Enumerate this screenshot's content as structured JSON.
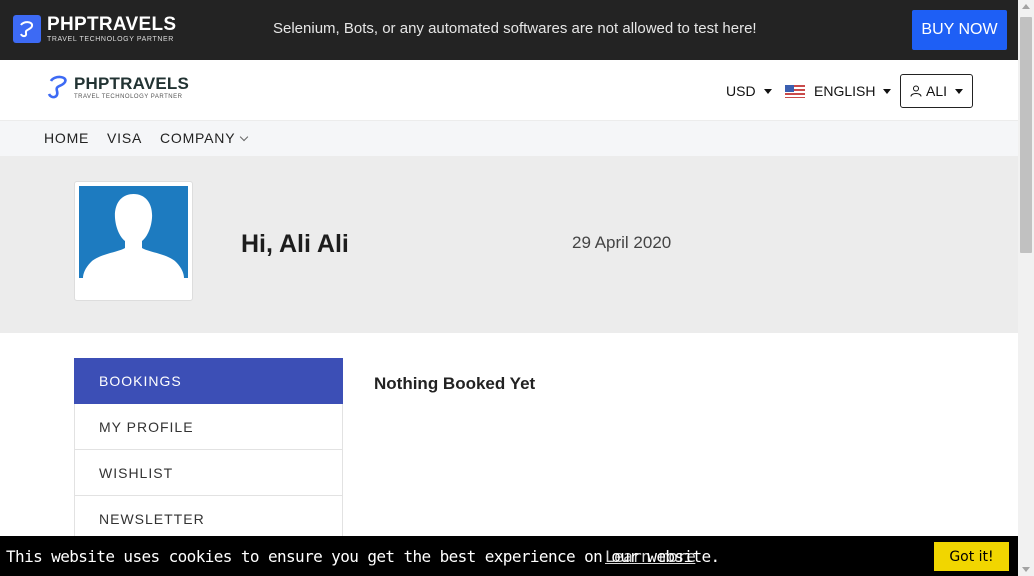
{
  "topbar": {
    "logo_name": "PHPTRAVELS",
    "logo_tagline": "TRAVEL TECHNOLOGY PARTNER",
    "notice": "Selenium, Bots, or any automated softwares are not allowed to test here!",
    "buy_label": "BUY NOW"
  },
  "header": {
    "logo_name": "PHPTRAVELS",
    "logo_tagline": "TRAVEL TECHNOLOGY PARTNER",
    "currency": "USD",
    "language": "ENGLISH",
    "user": "ALI"
  },
  "nav": {
    "items": [
      "HOME",
      "VISA",
      "COMPANY"
    ]
  },
  "profile": {
    "greeting": "Hi, Ali Ali",
    "date": "29 April 2020"
  },
  "sidebar": {
    "items": [
      "BOOKINGS",
      "MY PROFILE",
      "WISHLIST",
      "NEWSLETTER"
    ],
    "active": "BOOKINGS"
  },
  "main": {
    "empty_message": "Nothing Booked Yet"
  },
  "cookie": {
    "message": "This website uses cookies to ensure you get the best experience on our website.",
    "learn_more": "Learn more",
    "accept": "Got it!"
  },
  "colors": {
    "topbar_bg": "#232323",
    "buy_button": "#1e5ff5",
    "sidebar_active": "#3c4fb6",
    "cookie_button": "#f1d600",
    "avatar_bg": "#1d7bc0"
  }
}
